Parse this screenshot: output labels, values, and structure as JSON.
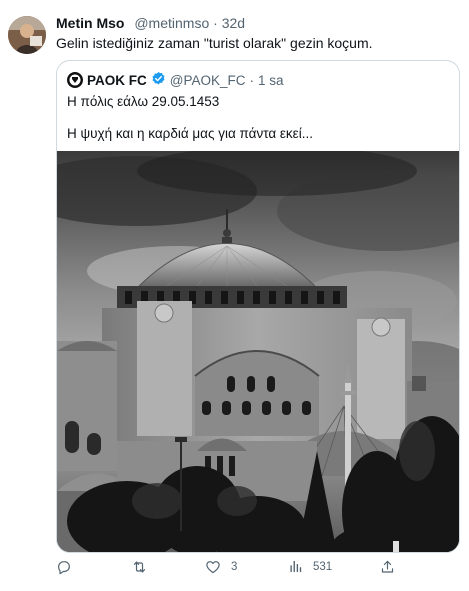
{
  "tweet": {
    "author_name": "Metin Mso",
    "author_handle": "@metinmso",
    "separator": "·",
    "age": "32d",
    "text": "Gelin istediğiniz zaman \"turist olarak\" gezin koçum."
  },
  "quoted_tweet": {
    "author_name": "PAOK FC",
    "author_handle": "@PAOK_FC",
    "separator": "·",
    "age": "1 sa",
    "line1": "Η πόλις εάλω 29.05.1453",
    "line2": "Η ψυχή και η καρδιά μας για πάντα εκεί...",
    "image_icon": "hagia-sophia-photo"
  },
  "actions": {
    "reply_icon": "reply-icon",
    "retweet_icon": "retweet-icon",
    "like_icon": "heart-icon",
    "like_count": "3",
    "views_icon": "analytics-icon",
    "views_count": "531",
    "share_icon": "share-icon"
  },
  "colors": {
    "text_primary": "#0f1419",
    "text_secondary": "#536471",
    "verified_blue": "#1d9bf0",
    "border": "#cfd9de"
  }
}
